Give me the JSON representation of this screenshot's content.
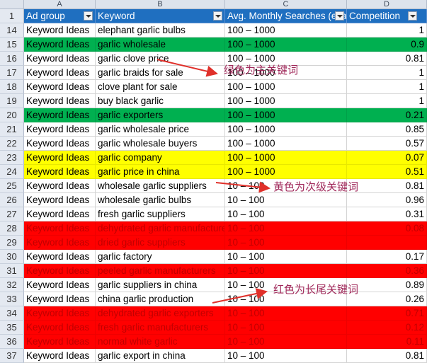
{
  "column_letters": [
    "A",
    "B",
    "C",
    "D"
  ],
  "header": {
    "row_num": "1",
    "ad_group": "Ad group",
    "keyword": "Keyword",
    "searches": "Avg. Monthly Searches (exa",
    "competition": "Competition"
  },
  "rows": [
    {
      "num": "14",
      "a": "Keyword Ideas",
      "b": "elephant garlic bulbs",
      "c": "100 – 1000",
      "d": "1",
      "fill": "white"
    },
    {
      "num": "15",
      "a": "Keyword Ideas",
      "b": "garlic wholesale",
      "c": "100 – 1000",
      "d": "0.9",
      "fill": "green"
    },
    {
      "num": "16",
      "a": "Keyword Ideas",
      "b": "garlic clove price",
      "c": "100 – 1000",
      "d": "0.81",
      "fill": "white"
    },
    {
      "num": "17",
      "a": "Keyword Ideas",
      "b": "garlic braids for sale",
      "c": "100 – 1000",
      "d": "1",
      "fill": "white"
    },
    {
      "num": "18",
      "a": "Keyword Ideas",
      "b": "clove plant for sale",
      "c": "100 – 1000",
      "d": "1",
      "fill": "white"
    },
    {
      "num": "19",
      "a": "Keyword Ideas",
      "b": "buy black garlic",
      "c": "100 – 1000",
      "d": "1",
      "fill": "white"
    },
    {
      "num": "20",
      "a": "Keyword Ideas",
      "b": "garlic exporters",
      "c": "100 – 1000",
      "d": "0.21",
      "fill": "green"
    },
    {
      "num": "21",
      "a": "Keyword Ideas",
      "b": "garlic wholesale price",
      "c": "100 – 1000",
      "d": "0.85",
      "fill": "white"
    },
    {
      "num": "22",
      "a": "Keyword Ideas",
      "b": "garlic wholesale buyers",
      "c": "100 – 1000",
      "d": "0.57",
      "fill": "white"
    },
    {
      "num": "23",
      "a": "Keyword Ideas",
      "b": "garlic company",
      "c": "100 – 1000",
      "d": "0.07",
      "fill": "yellow"
    },
    {
      "num": "24",
      "a": "Keyword Ideas",
      "b": "garlic price in china",
      "c": "100 – 1000",
      "d": "0.51",
      "fill": "yellow"
    },
    {
      "num": "25",
      "a": "Keyword Ideas",
      "b": "wholesale garlic suppliers",
      "c": "10 – 100",
      "d": "0.81",
      "fill": "white"
    },
    {
      "num": "26",
      "a": "Keyword Ideas",
      "b": "wholesale garlic bulbs",
      "c": "10 – 100",
      "d": "0.96",
      "fill": "white"
    },
    {
      "num": "27",
      "a": "Keyword Ideas",
      "b": "fresh garlic suppliers",
      "c": "10 – 100",
      "d": "0.31",
      "fill": "white"
    },
    {
      "num": "28",
      "a": "Keyword Ideas",
      "b": "dehydrated garlic manufacture",
      "c": "10 – 100",
      "d": "0.08",
      "fill": "red"
    },
    {
      "num": "29",
      "a": "Keyword Ideas",
      "b": "dried garlic suppliers",
      "c": "10 – 100",
      "d": "",
      "fill": "red"
    },
    {
      "num": "30",
      "a": "Keyword Ideas",
      "b": "garlic factory",
      "c": "10 – 100",
      "d": "0.17",
      "fill": "white"
    },
    {
      "num": "31",
      "a": "Keyword Ideas",
      "b": "peeled garlic manufacturers",
      "c": "10 – 100",
      "d": "0.36",
      "fill": "red"
    },
    {
      "num": "32",
      "a": "Keyword Ideas",
      "b": "garlic suppliers in china",
      "c": "10 – 100",
      "d": "0.89",
      "fill": "white"
    },
    {
      "num": "33",
      "a": "Keyword Ideas",
      "b": "china garlic production",
      "c": "10 – 100",
      "d": "0.26",
      "fill": "white"
    },
    {
      "num": "34",
      "a": "Keyword Ideas",
      "b": "dehydrated garlic exporters",
      "c": "10 – 100",
      "d": "0.71",
      "fill": "red"
    },
    {
      "num": "35",
      "a": "Keyword Ideas",
      "b": "fresh garlic manufacturers",
      "c": "10 – 100",
      "d": "0.12",
      "fill": "red"
    },
    {
      "num": "36",
      "a": "Keyword Ideas",
      "b": "normal white garlic",
      "c": "10 – 100",
      "d": "0.11",
      "fill": "red"
    },
    {
      "num": "37",
      "a": "Keyword Ideas",
      "b": "garlic export in china",
      "c": "10 – 100",
      "d": "0.81",
      "fill": "white"
    }
  ],
  "annotations": {
    "green_note": "绿色为主关键词",
    "yellow_note": "黄色为次级关键词",
    "red_note": "红色为长尾关键词",
    "color": "#a0285a"
  },
  "colors": {
    "green": "#00b050",
    "yellow": "#ffff00",
    "red": "#ff0000",
    "header_blue": "#1f6fc0"
  }
}
